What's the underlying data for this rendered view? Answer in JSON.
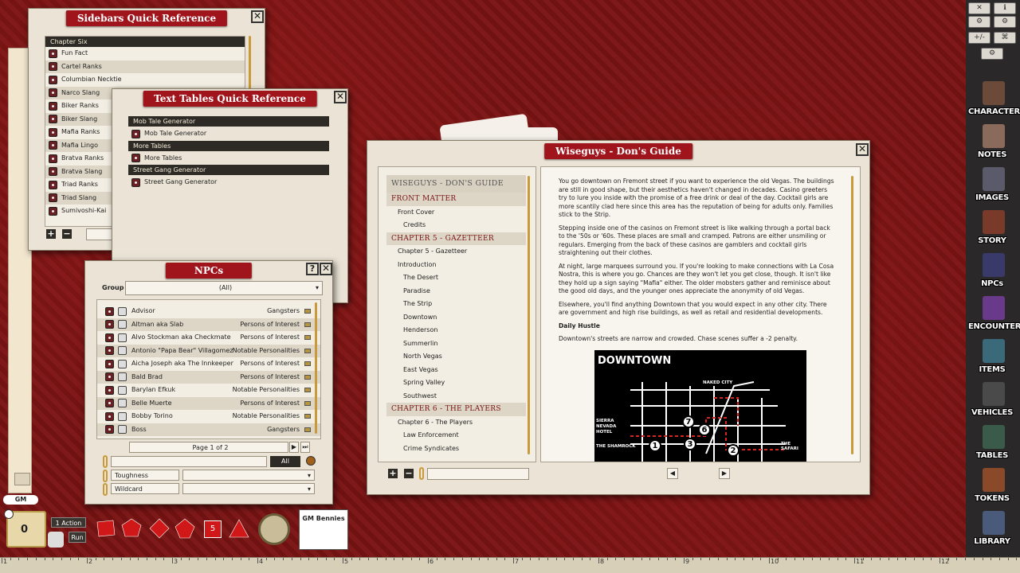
{
  "sidebars_ref": {
    "title": "Sidebars Quick Reference",
    "header": "Chapter Six",
    "items": [
      "Fun Fact",
      "Cartel Ranks",
      "Columbian Necktie",
      "Narco Slang",
      "Biker Ranks",
      "Biker Slang",
      "Mafia Ranks",
      "Mafia Lingo",
      "Bratva Ranks",
      "Bratva Slang",
      "Triad Ranks",
      "Triad Slang",
      "Sumivoshi-Kai"
    ]
  },
  "text_tables": {
    "title": "Text Tables Quick Reference",
    "groups": [
      {
        "header": "Mob Tale Generator",
        "item": "Mob Tale Generator"
      },
      {
        "header": "More Tables",
        "item": "More Tables"
      },
      {
        "header": "Street Gang Generator",
        "item": "Street Gang Generator"
      }
    ]
  },
  "npcs": {
    "title": "NPCs",
    "help": "?",
    "group_label": "Group",
    "group_value": "(All)",
    "rows": [
      [
        "Advisor",
        "Gangsters"
      ],
      [
        "Altman aka Slab",
        "Persons of Interest"
      ],
      [
        "Alvo Stockman aka Checkmate",
        "Persons of Interest"
      ],
      [
        "Antonio \"Papa Bear\" Villagomez",
        "Notable Personalities"
      ],
      [
        "Aicha Joseph aka The Innkeeper",
        "Persons of Interest"
      ],
      [
        "Bald Brad",
        "Persons of Interest"
      ],
      [
        "Barylan Efkuk",
        "Notable Personalities"
      ],
      [
        "Belle Muerte",
        "Persons of Interest"
      ],
      [
        "Bobby Torino",
        "Notable Personalities"
      ],
      [
        "Boss",
        "Gangsters"
      ]
    ],
    "page": "Page 1 of 2",
    "all_button": "All",
    "filter1": "Toughness",
    "filter2": "Wildcard"
  },
  "guide": {
    "title": "Wiseguys - Don's Guide",
    "toc": [
      {
        "t": "Wiseguys - Don's Guide",
        "k": "top"
      },
      {
        "t": "Front Matter",
        "k": "sec"
      },
      {
        "t": "Front Cover",
        "k": "l1"
      },
      {
        "t": "Credits",
        "k": "l2"
      },
      {
        "t": "Chapter 5 - Gazetteer",
        "k": "sec"
      },
      {
        "t": "Chapter 5 - Gazetteer",
        "k": "l1"
      },
      {
        "t": "Introduction",
        "k": "l1"
      },
      {
        "t": "The Desert",
        "k": "l2"
      },
      {
        "t": "Paradise",
        "k": "l2"
      },
      {
        "t": "The Strip",
        "k": "l2"
      },
      {
        "t": "Downtown",
        "k": "l2"
      },
      {
        "t": "Henderson",
        "k": "l2"
      },
      {
        "t": "Summerlin",
        "k": "l2"
      },
      {
        "t": "North Vegas",
        "k": "l2"
      },
      {
        "t": "East Vegas",
        "k": "l2"
      },
      {
        "t": "Spring Valley",
        "k": "l2"
      },
      {
        "t": "Southwest",
        "k": "l2"
      },
      {
        "t": "Chapter 6 - The Players",
        "k": "sec"
      },
      {
        "t": "Chapter 6 - The Players",
        "k": "l1"
      },
      {
        "t": "Law Enforcement",
        "k": "l2"
      },
      {
        "t": "Crime Syndicates",
        "k": "l2"
      }
    ],
    "p1": "You go downtown on Fremont street if you want to experience the old Vegas. The buildings are still in good shape, but their aesthetics haven't changed in decades. Casino greeters try to lure you inside with the promise of a free drink or deal of the day. Cocktail girls are more scantily clad here since this area has the reputation of being for adults only. Families stick to the Strip.",
    "p2": "Stepping inside one of the casinos on Fremont street is like walking through a portal back to the '50s or '60s. These places are small and cramped. Patrons are either unsmiling or regulars. Emerging from the back of these casinos are gamblers and cocktail girls straightening out their clothes.",
    "p3": "At night, large marquees surround you. If you're looking to make connections with La Cosa Nostra, this is where you go. Chances are they won't let you get close, though. It isn't like they hold up a sign saying \"Mafia\" either. The older mobsters gather and reminisce about the good old days, and the younger ones appreciate the anonymity of old Vegas.",
    "p4": "Elsewhere, you'll find anything Downtown that you would expect in any other city. There are government and high rise buildings, as well as retail and residential developments.",
    "h1": "Daily Hustle",
    "p5": "Downtown's streets are narrow and crowded. Chase scenes suffer a -2 penalty.",
    "map": {
      "title": "DOWNTOWN",
      "labels": [
        "NAKED CITY",
        "SIERRA NEVADA HOTEL",
        "THE SHAMROCK",
        "THE SAFARI"
      ],
      "markers": [
        "7",
        "6",
        "1",
        "3",
        "2"
      ]
    }
  },
  "sidebar_buttons": [
    "CHARACTERS",
    "NOTES",
    "IMAGES",
    "STORY",
    "NPCs",
    "ENCOUNTERS",
    "ITEMS",
    "VEHICLES",
    "TABLES",
    "TOKENS",
    "LIBRARY"
  ],
  "tools": [
    "✕",
    "ℹ",
    "⚙",
    "⚙",
    "+/-",
    "⌘",
    "⚙"
  ],
  "bottom": {
    "gm": "GM",
    "counter": "0",
    "action": "1 Action",
    "run": "Run",
    "die_label": "5",
    "bennies": "GM Bennies"
  },
  "ruler": [
    "1",
    "2",
    "3",
    "4",
    "5",
    "6",
    "7",
    "8",
    "9",
    "10",
    "11",
    "12"
  ],
  "colors": {
    "accent": "#a0141c",
    "panel": "#ebe4d6",
    "header": "#2e2b26"
  }
}
